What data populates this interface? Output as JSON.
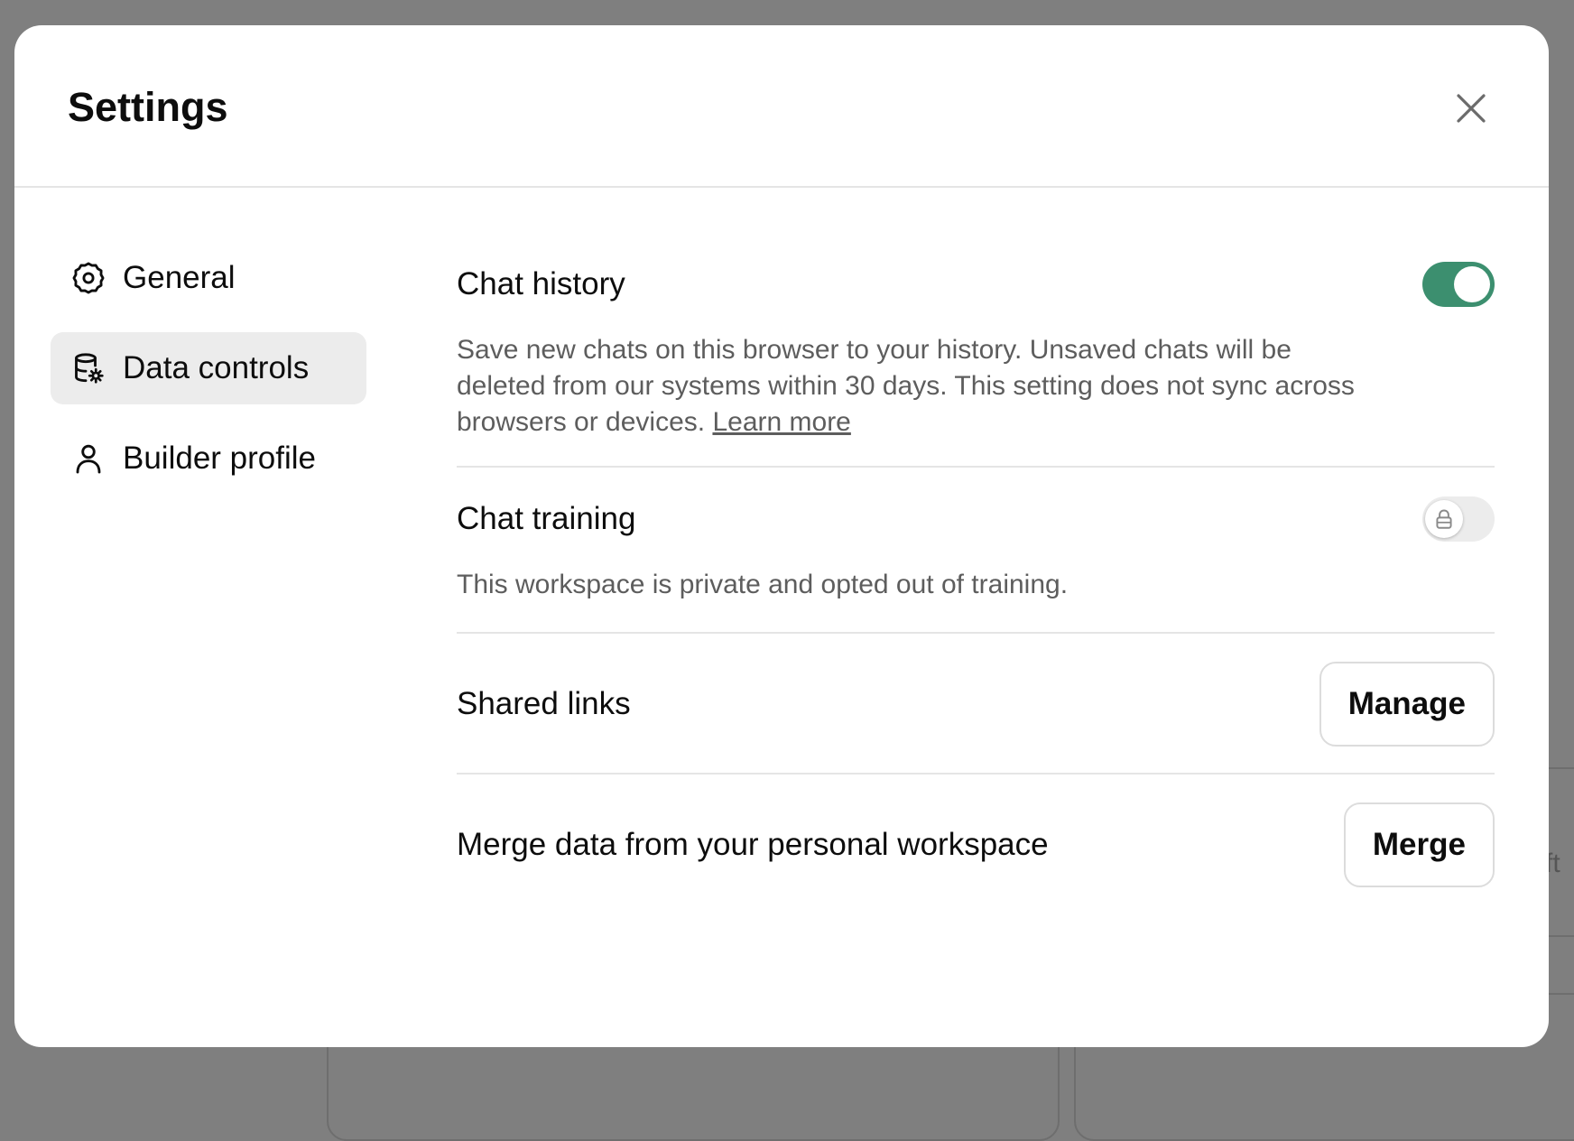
{
  "modal": {
    "title": "Settings"
  },
  "sidebar": {
    "items": [
      {
        "label": "General",
        "icon": "gear-icon",
        "active": false
      },
      {
        "label": "Data controls",
        "icon": "database-gear-icon",
        "active": true
      },
      {
        "label": "Builder profile",
        "icon": "person-icon",
        "active": false
      }
    ]
  },
  "chat_history": {
    "label": "Chat history",
    "enabled": true,
    "description": "Save new chats on this browser to your history. Unsaved chats will be deleted from our systems within 30 days. This setting does not sync across browsers or devices.",
    "learn_more": "Learn more"
  },
  "chat_training": {
    "label": "Chat training",
    "enabled": false,
    "locked": true,
    "description": "This workspace is private and opted out of training."
  },
  "shared_links": {
    "label": "Shared links",
    "button_label": "Manage"
  },
  "merge_data": {
    "label": "Merge data from your personal workspace",
    "button_label": "Merge"
  },
  "colors": {
    "toggle_on": "#3c8f6f",
    "toggle_off": "#ececec",
    "active_nav_bg": "#ececec",
    "overlay": "#7f7f7f"
  },
  "background": {
    "partial_text": "ft"
  }
}
